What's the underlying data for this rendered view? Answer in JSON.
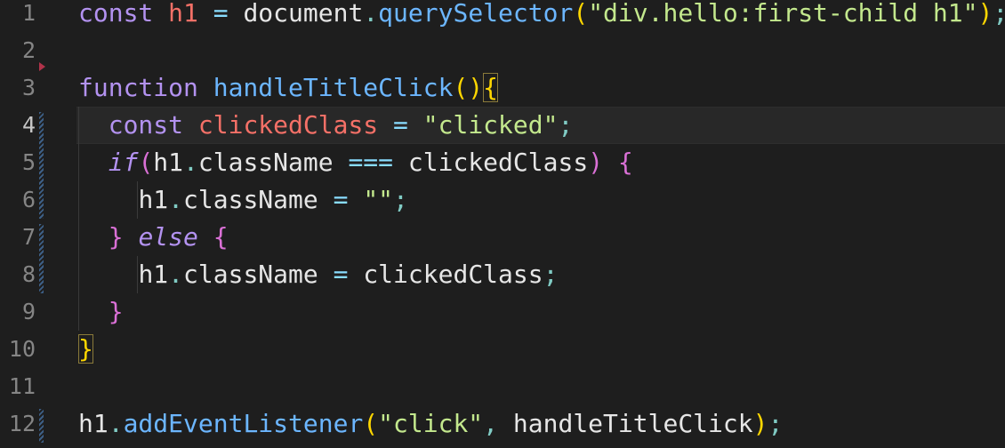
{
  "editor": {
    "line_numbers": [
      "1",
      "2",
      "3",
      "4",
      "5",
      "6",
      "7",
      "8",
      "9",
      "10",
      "11",
      "12"
    ],
    "active_line": "4"
  },
  "code": {
    "l1": {
      "const": "const",
      "h1": "h1",
      "eq": "=",
      "document": "document",
      "dot": ".",
      "method": "querySelector",
      "lparen": "(",
      "arg": "\"div.hello:first-child h1\"",
      "rparen": ")",
      "semi": ";"
    },
    "l3": {
      "function": "function",
      "name": "handleTitleClick",
      "parens": "()",
      "lbrace": "{"
    },
    "l4": {
      "const": "const",
      "name": "clickedClass",
      "eq": "=",
      "value": "\"clicked\"",
      "semi": ";"
    },
    "l5": {
      "if": "if",
      "lparen": "(",
      "h1": "h1",
      "dot": ".",
      "prop": "className",
      "op": "===",
      "rhs": "clickedClass",
      "rparen": ")",
      "lbrace": "{"
    },
    "l6": {
      "h1": "h1",
      "dot": ".",
      "prop": "className",
      "eq": "=",
      "value": "\"\"",
      "semi": ";"
    },
    "l7": {
      "rbrace": "}",
      "else": "else",
      "lbrace": "{"
    },
    "l8": {
      "h1": "h1",
      "dot": ".",
      "prop": "className",
      "eq": "=",
      "rhs": "clickedClass",
      "semi": ";"
    },
    "l9": {
      "rbrace": "}"
    },
    "l10": {
      "rbrace": "}"
    },
    "l12": {
      "h1": "h1",
      "dot": ".",
      "method": "addEventListener",
      "lparen": "(",
      "event": "\"click\"",
      "comma": ",",
      "handler": "handleTitleClick",
      "rparen": ")",
      "semi": ";"
    }
  },
  "colors": {
    "background": "#1e1e1e",
    "keyword": "#c586c0",
    "function": "#6cb6ff",
    "string": "#c3e88d",
    "variable_def": "#f47067",
    "bracket": "#ffd700"
  }
}
